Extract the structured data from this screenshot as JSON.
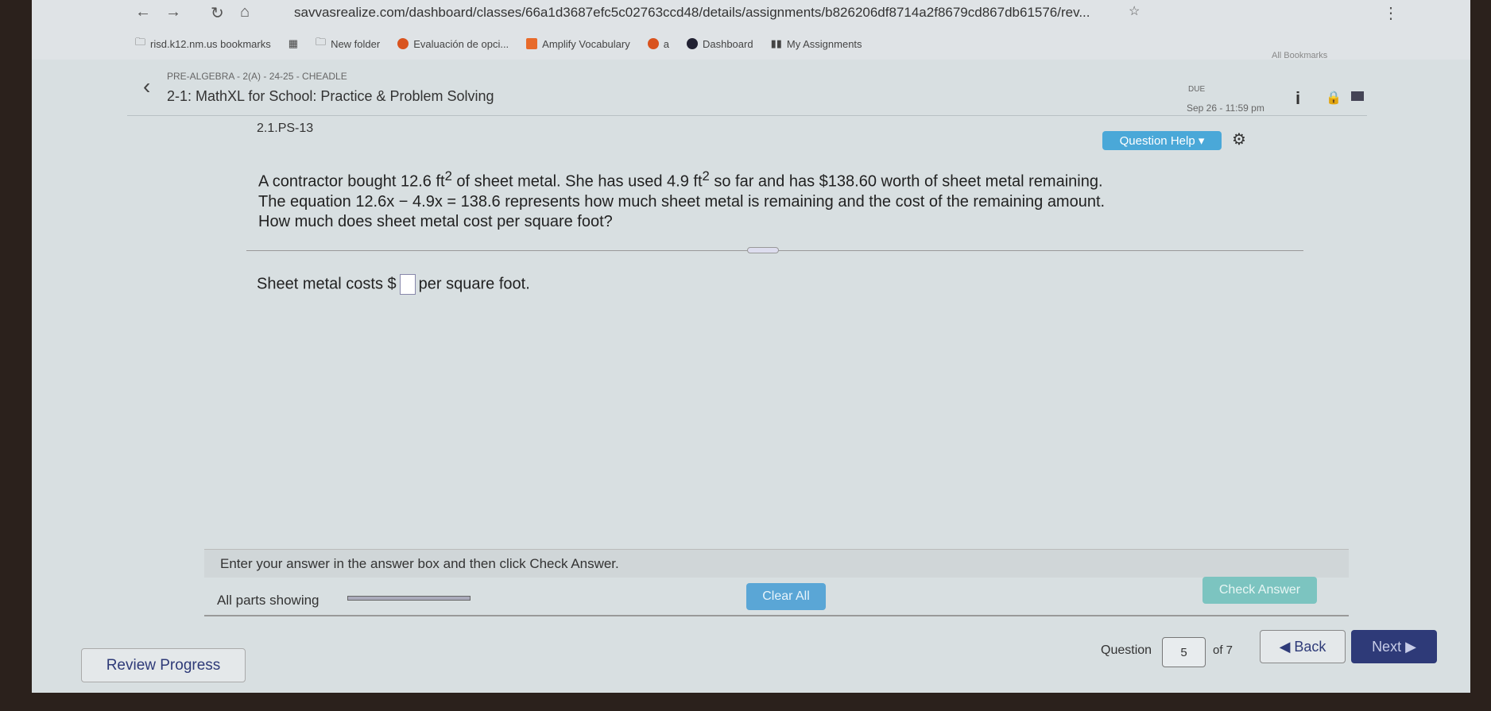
{
  "browser": {
    "url": "savvasrealize.com/dashboard/classes/66a1d3687efc5c02763ccd48/details/assignments/b826206df8714a2f8679cd867db61576/rev...",
    "bookmarks": [
      "risd.k12.nm.us bookmarks",
      "New folder",
      "Evaluación de opci...",
      "Amplify Vocabulary",
      "a",
      "Dashboard",
      "My Assignments"
    ],
    "all_bookmarks": "All Bookmarks"
  },
  "header": {
    "breadcrumb": "PRE-ALGEBRA - 2(A) - 24-25 - CHEADLE",
    "title": "2-1: MathXL for School: Practice & Problem Solving",
    "due_label": "DUE",
    "due_date": "Sep 26 - 11:59 pm"
  },
  "question": {
    "id": "2.1.PS-13",
    "help_label": "Question Help",
    "line1_a": "A contractor bought 12.6 ft",
    "line1_b": " of sheet metal. She has used 4.9 ft",
    "line1_c": " so far and has $138.60 worth of sheet metal remaining.",
    "sup": "2",
    "line2": "The equation 12.6x − 4.9x = 138.6 represents how much sheet metal is remaining and the cost of the remaining amount.",
    "line3": "How much does sheet metal cost per square foot?",
    "answer_prefix": "Sheet metal costs $",
    "answer_suffix": "per square foot.",
    "answer_value": ""
  },
  "instruction": "Enter your answer in the answer box and then click Check Answer.",
  "controls": {
    "parts": "All parts showing",
    "clear_all": "Clear All",
    "check_answer": "Check Answer"
  },
  "footer": {
    "review": "Review Progress",
    "question_label": "Question",
    "question_number": "5",
    "of_total": "of 7",
    "back": "◀ Back",
    "next": "Next ▶"
  },
  "colors": {
    "clear_all": "#5aa6d6",
    "check_answer": "#7cc4c0",
    "next": "#2e3a78",
    "help": "#4aa8d8"
  }
}
